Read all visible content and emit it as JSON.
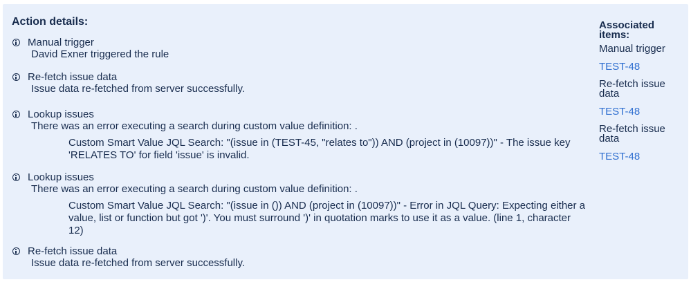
{
  "heading": "Action details:",
  "entries": [
    {
      "title": "Manual trigger",
      "message": "David Exner triggered the rule"
    },
    {
      "title": "Re-fetch issue data",
      "message": "Issue data re-fetched from server successfully."
    },
    {
      "title": "Lookup issues",
      "message": "There was an error executing a search during custom value definition: .",
      "detail": "Custom Smart Value JQL Search: \"(issue in (TEST-45, \"relates to\")) AND (project in (10097))\" - The issue key 'RELATES TO' for field 'issue' is invalid."
    },
    {
      "title": "Lookup issues",
      "message": "There was an error executing a search during custom value definition: .",
      "detail": "Custom Smart Value JQL Search: \"(issue in ()) AND (project in (10097))\" - Error in JQL Query: Expecting either a value, list or function but got ')'. You must surround ')' in quotation marks to use it as a value. (line 1, character 12)"
    },
    {
      "title": "Re-fetch issue data",
      "message": "Issue data re-fetched from server successfully."
    }
  ],
  "sidebar": {
    "heading": "Associated items:",
    "groups": [
      {
        "label": "Manual trigger",
        "link": "TEST-48"
      },
      {
        "label": "Re-fetch issue data",
        "link": "TEST-48"
      },
      {
        "label": "Re-fetch issue data",
        "link": "TEST-48"
      }
    ]
  },
  "colors": {
    "panel_bg": "#e9f0fb",
    "text": "#172b4d",
    "link": "#2f6fd0"
  },
  "icon": "info-icon"
}
